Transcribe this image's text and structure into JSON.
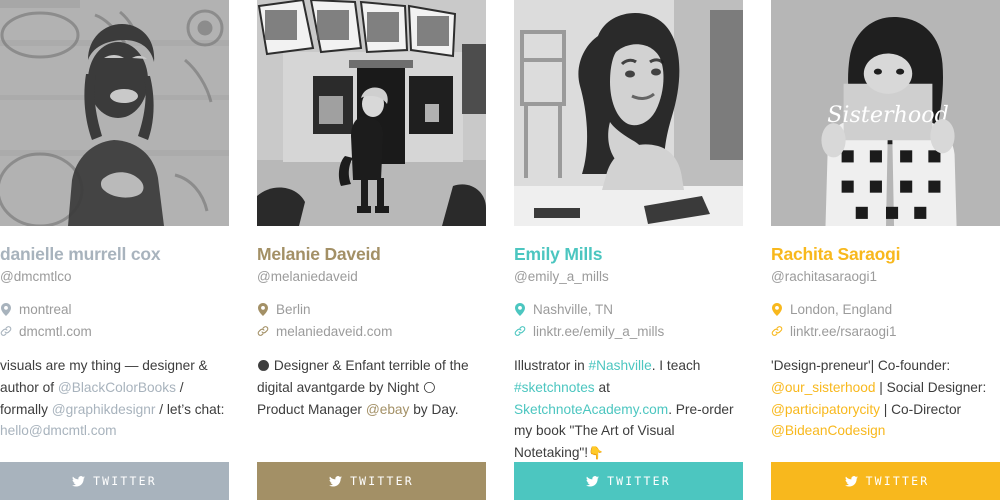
{
  "cards": [
    {
      "accent": "#a8b3bd",
      "name": "danielle murrell cox",
      "handle": "@dmcmtlco",
      "location": "montreal",
      "website": "dmcmtl.com",
      "button_label": "Twitter",
      "photo_alt": "woman smiling in front of graffiti wall",
      "bio_parts": [
        {
          "text": "visuals are my thing — designer & author of ",
          "type": "text"
        },
        {
          "text": "@BlackColorBooks",
          "type": "mention"
        },
        {
          "text": " / formally ",
          "type": "text"
        },
        {
          "text": "@graphikdesignr",
          "type": "mention"
        },
        {
          "text": " / let’s chat: ",
          "type": "text"
        },
        {
          "text": "hello@dmcmtl.com",
          "type": "mention"
        }
      ]
    },
    {
      "accent": "#a39066",
      "name": "Melanie Daveid",
      "handle": "@melaniedaveid",
      "location": "Berlin",
      "website": "melaniedaveid.com",
      "button_label": "Twitter",
      "photo_alt": "person standing in front of Venice storefront sign",
      "bio_parts": [
        {
          "text": "🌑",
          "type": "emoji"
        },
        {
          "text": "  Designer & Enfant terrible of the digital avantgarde by Night ",
          "type": "text"
        },
        {
          "text": "🌕",
          "type": "emoji"
        },
        {
          "text": " Product Manager ",
          "type": "text"
        },
        {
          "text": "@ebay",
          "type": "mention"
        },
        {
          "text": " by Day.",
          "type": "text"
        }
      ]
    },
    {
      "accent": "#4cc6c0",
      "name": "Emily Mills",
      "handle": "@emily_a_mills",
      "location": "Nashville, TN",
      "website": "linktr.ee/emily_a_mills",
      "button_label": "Twitter",
      "photo_alt": "woman resting chin on hand at a table",
      "bio_parts": [
        {
          "text": "Illustrator in ",
          "type": "text"
        },
        {
          "text": "#Nashville",
          "type": "mention"
        },
        {
          "text": ". I teach ",
          "type": "text"
        },
        {
          "text": "#sketchnotes",
          "type": "mention"
        },
        {
          "text": " at ",
          "type": "text"
        },
        {
          "text": "SketchnoteAcademy.com",
          "type": "mention"
        },
        {
          "text": ". Pre-order my book \"The Art of Visual Notetaking\"!",
          "type": "text"
        },
        {
          "text": "👇",
          "type": "emoji"
        }
      ]
    },
    {
      "accent": "#f8b81d",
      "name": "Rachita Saraogi",
      "handle": "@rachitasaraogi1",
      "location": "London, England",
      "website": "linktr.ee/rsaraogi1",
      "button_label": "Twitter",
      "photo_alt": "person holding a Sisterhood sign in front of face",
      "bio_parts": [
        {
          "text": "'Design-preneur'| Co-founder: ",
          "type": "text"
        },
        {
          "text": "@our_sisterhood",
          "type": "mention"
        },
        {
          "text": " | Social Designer: ",
          "type": "text"
        },
        {
          "text": "@participatorycity",
          "type": "mention"
        },
        {
          "text": " | Co-Director ",
          "type": "text"
        },
        {
          "text": "@BideanCodesign",
          "type": "mention"
        }
      ]
    }
  ],
  "icons": {
    "location": "map-pin-icon",
    "website": "link-icon",
    "button": "twitter-bird-icon"
  }
}
